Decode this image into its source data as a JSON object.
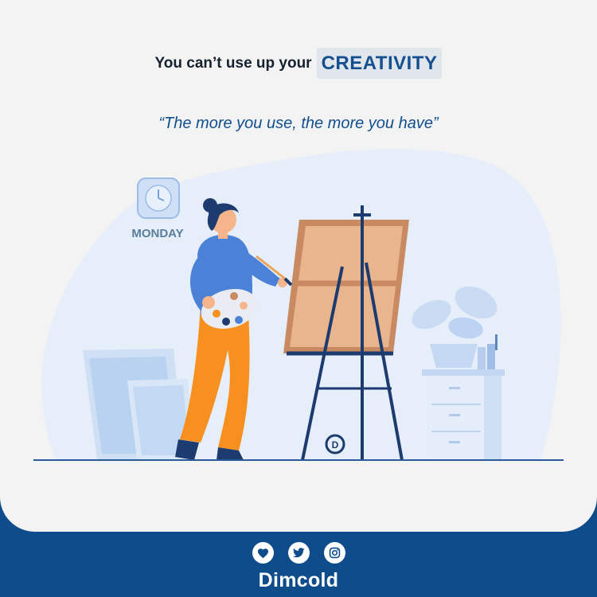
{
  "headline": {
    "lead": "You can’t use up your",
    "accent": "CREATIVITY"
  },
  "quote": "“The more you use, the more you have”",
  "illustration": {
    "clock_label": "MONDAY",
    "icons": [
      "clock-icon",
      "palette-icon",
      "brush-icon",
      "easel-icon",
      "plant-icon",
      "dimcold-logo-icon"
    ]
  },
  "footer": {
    "social_icons": [
      "heart-icon",
      "twitter-icon",
      "instagram-icon"
    ],
    "brand": "Dimcold"
  },
  "colors": {
    "brand_blue": "#0f4c8c",
    "accent_text": "#14508f",
    "background": "#f3f3f3",
    "shirt": "#4b82d8",
    "pants": "#f7901e",
    "canvas": "#e9b58f"
  }
}
